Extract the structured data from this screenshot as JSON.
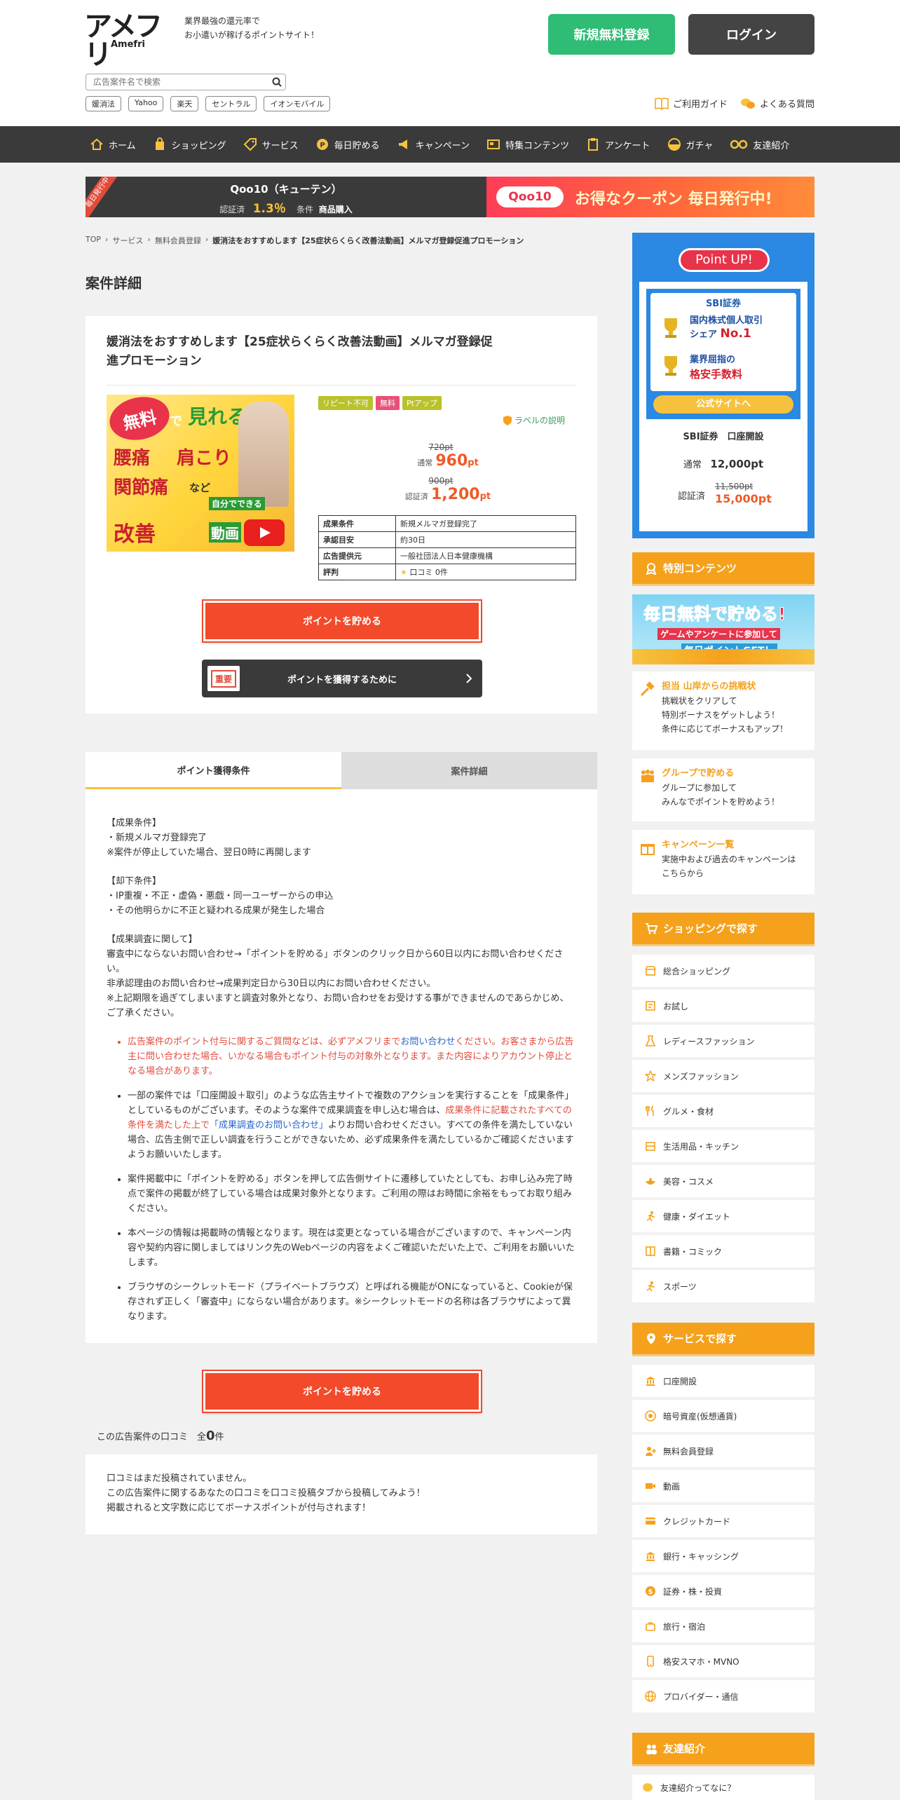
{
  "header": {
    "logo_text": "アメフリ",
    "logo_sub": "Amefri",
    "tagline_1": "業界最強の還元率で",
    "tagline_2": "お小遣いが稼げるポイントサイト！",
    "register_label": "新規無料登録",
    "login_label": "ログイン",
    "search_placeholder": "広告案件名で検索",
    "tags": [
      "媛消法",
      "Yahoo",
      "楽天",
      "セントラル",
      "イオンモバイル"
    ],
    "guide_label": "ご利用ガイド",
    "faq_label": "よくある質問"
  },
  "nav": [
    "ホーム",
    "ショッピング",
    "サービス",
    "毎日貯める",
    "キャンペーン",
    "特集コンテンツ",
    "アンケート",
    "ガチャ",
    "友達紹介"
  ],
  "banner": {
    "ribbon": "毎日発行中",
    "title": "Qoo10（キューテン）",
    "status": "認証済",
    "rate": "1.3％",
    "condition_label": "条件",
    "condition": "商品購入",
    "qoo_logo": "Qoo10",
    "promo": "お得なクーポン 毎日発行中!"
  },
  "breadcrumb": [
    "TOP",
    "サービス",
    "無料会員登録",
    "媛消法をおすすめします【25症状らくらく改善法動画】メルマガ登録促進プロモーション"
  ],
  "section_title": "案件詳細",
  "product": {
    "title": "媛消法をおすすめします【25症状らくらく改善法動画】メルマガ登録促進プロモーション",
    "image_text": [
      "無料",
      "で",
      "見れる!",
      "腰痛",
      "肩こり",
      "関節痛",
      "など",
      "自分でできる",
      "改善",
      "動画"
    ],
    "labels": [
      "リピート不可",
      "無料",
      "Ptアップ"
    ],
    "label_help": "ラベルの説明",
    "normal_old": "720pt",
    "normal_label": "通常",
    "normal_pt": "960",
    "cert_old": "900pt",
    "cert_label": "認証済",
    "cert_pt": "1,200",
    "pt_unit": "pt",
    "info": [
      {
        "k": "成果条件",
        "v": "新規メルマガ登録完了"
      },
      {
        "k": "承認目安",
        "v": "約30日"
      },
      {
        "k": "広告提供元",
        "v": "一般社団法人日本健康機構"
      },
      {
        "k": "評判",
        "v": "口コミ 0件"
      }
    ],
    "earn_label": "ポイントを貯める",
    "important_badge": "重要",
    "important_label": "ポイントを獲得するために"
  },
  "tabs": [
    "ポイント獲得条件",
    "案件詳細"
  ],
  "detail": {
    "p1": [
      "【成果条件】",
      "・新規メルマガ登録完了",
      "※案件が停止していた場合、翌日0時に再開します"
    ],
    "p2": [
      "【却下条件】",
      "・IP重複・不正・虚偽・悪戯・同一ユーザーからの申込",
      "・その他明らかに不正と疑われる成果が発生した場合"
    ],
    "p3": [
      "【成果調査に関して】",
      "審査中にならないお問い合わせ→「ポイントを貯める」ボタンのクリック日から60日以内にお問い合わせください。",
      "非承認理由のお問い合わせ→成果判定日から30日以内にお問い合わせください。",
      "※上記期限を過ぎてしまいますと調査対象外となり、お問い合わせをお受けする事ができませんのであらかじめ、ご了承ください。"
    ],
    "b1a": "広告案件のポイント付与に関するご質問などは、必ずアメフリまで",
    "b1link": "お問い合わせ",
    "b1b": "ください。お客さまから広告主に問い合わせた場合、いかなる場合もポイント付与の対象外となります。また内容によりアカウント停止となる場合があります。",
    "b2a": "一部の案件では「口座開設＋取引」のような広告主サイトで複数のアクションを実行することを「成果条件」としているものがございます。そのような案件で成果調査を申し込む場合は、",
    "b2red": "成果条件に記載されたすべての条件を満たした上で",
    "b2link": "「成果調査のお問い合わせ」",
    "b2b": "よりお問い合わせください。すべての条件を満たしていない場合、広告主側で正しい調査を行うことができないため、必ず成果条件を満たしているかご確認くださいますようお願いいたします。",
    "b3": "案件掲載中に「ポイントを貯める」ボタンを押して広告側サイトに遷移していたとしても、お申し込み完了時点で案件の掲載が終了している場合は成果対象外となります。ご利用の際はお時間に余裕をもってお取り組みください。",
    "b4": "本ページの情報は掲載時の情報となります。現在は変更となっている場合がございますので、キャンペーン内容や契約内容に関しましてはリンク先のWebページの内容をよくご確認いただいた上で、ご利用をお願いいたします。",
    "b5": "ブラウザのシークレットモード（プライベートブラウズ）と呼ばれる機能がONになっていると、Cookieが保存されず正しく「審査中」にならない場合があります。※シークレットモードの名称は各ブラウザによって異なります。"
  },
  "bottom_earn_label": "ポイントを貯める",
  "reviews": {
    "head": "この広告案件の口コミ　全",
    "count": "0",
    "unit": "件",
    "lines": [
      "口コミはまだ投稿されていません。",
      "この広告案件に関するあなたの口コミを口コミ投稿タブから投稿してみよう！",
      "掲載されると文字数に応じてボーナスポイントが付与されます！"
    ]
  },
  "sidebar": {
    "pointup": "Point UP!",
    "sbi_logo": "SBI証券",
    "sbi_line1a": "国内株式個人取引",
    "sbi_line1b": "シェア",
    "sbi_no1": "No.1",
    "sbi_line2a": "業界屈指の",
    "sbi_line2b": "格安手数料",
    "sbi_btn": "公式サイトへ",
    "sbi_name": "SBI証券　口座開設",
    "normal_label": "通常",
    "normal_pt": "12,000pt",
    "cert_label": "認証済",
    "cert_old": "11,500pt",
    "cert_pt": "15,000pt",
    "special_head": "特別コンテンツ",
    "daily_banner_1": "毎日無料で貯める!",
    "daily_banner_2": "ゲームやアンケートに参加して",
    "daily_banner_3": "毎日ポイントGET！",
    "features": [
      {
        "title": "担当 山岸からの挑戦状",
        "lines": [
          "挑戦状をクリアして",
          "特別ボーナスをゲットしよう！",
          "条件に応じてボーナスもアップ！"
        ]
      },
      {
        "title": "グループで貯める",
        "lines": [
          "グループに参加して",
          "みんなでポイントを貯めよう！"
        ]
      },
      {
        "title": "キャンペーン一覧",
        "lines": [
          "実施中および過去のキャンペーンは",
          "こちらから"
        ]
      }
    ],
    "shopping_head": "ショッピングで探す",
    "shopping": [
      "総合ショッピング",
      "お試し",
      "レディースファッション",
      "メンズファッション",
      "グルメ・食材",
      "生活用品・キッチン",
      "美容・コスメ",
      "健康・ダイエット",
      "書籍・コミック",
      "スポーツ"
    ],
    "service_head": "サービスで探す",
    "services": [
      "口座開設",
      "暗号資産(仮想通貨)",
      "無料会員登録",
      "動画",
      "クレジットカード",
      "銀行・キャッシング",
      "証券・株・投資",
      "旅行・宿泊",
      "格安スマホ・MVNO",
      "プロバイダー・通信"
    ],
    "friend_head": "友達紹介",
    "friend_line": "友達紹介ってなに？"
  },
  "colors": {
    "accent": "#f5a11b",
    "primary_red": "#f24a2a",
    "register_green": "#2fbc74",
    "nav_dark": "#3a3a3a"
  }
}
